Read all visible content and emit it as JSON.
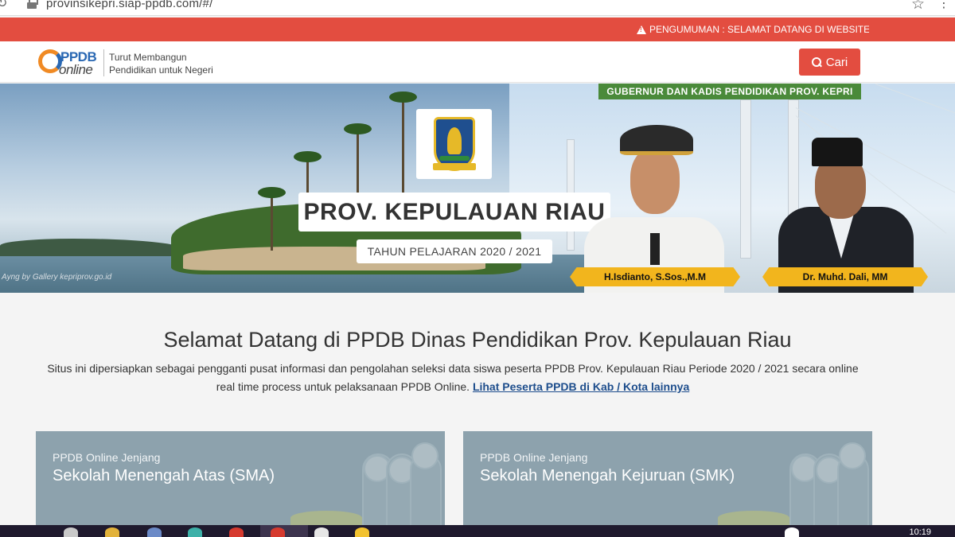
{
  "browser": {
    "url": "provinsikepri.siap-ppdb.com/#/"
  },
  "announcement": {
    "text": "PENGUMUMAN : SELAMAT DATANG DI WEBSITE PPD"
  },
  "header": {
    "logo_top": "PPDB",
    "logo_bottom": "online",
    "tagline_line1": "Turut Membangun",
    "tagline_line2": "Pendidikan untuk Negeri",
    "search_label": "Cari"
  },
  "banner": {
    "officials_label": "GUBERNUR DAN KADIS PENDIDIKAN PROV. KEPRI",
    "title": "PROV. KEPULAUAN RIAU",
    "year": "TAHUN PELAJARAN 2020 / 2021",
    "photo_credit": "Ayng by Gallery kepriprov.go.id",
    "governor_name": "H.Isdianto, S.Sos.,M.M",
    "head_name": "Dr. Muhd. Dali, MM"
  },
  "welcome": {
    "title": "Selamat Datang di PPDB Dinas Pendidikan Prov. Kepulauan Riau",
    "text": "Situs ini dipersiapkan sebagai pengganti pusat informasi dan pengolahan seleksi data siswa peserta PPDB Prov. Kepulauan Riau Periode 2020 / 2021 secara online real time process untuk pelaksanaan PPDB Online. ",
    "link": "Lihat Peserta PPDB di Kab / Kota lainnya"
  },
  "cards": [
    {
      "kicker": "PPDB Online Jenjang",
      "title": "Sekolah Menengah Atas (SMA)"
    },
    {
      "kicker": "PPDB Online Jenjang",
      "title": "Sekolah Menengah Kejuruan (SMK)"
    }
  ],
  "taskbar": {
    "clock": "10:19"
  },
  "colors": {
    "accent_red": "#e34d40",
    "card_bg": "#8da2ad",
    "nameplate_gold": "#f2b51d",
    "label_green": "#4a8a3a",
    "link_blue": "#1d4d8c"
  }
}
